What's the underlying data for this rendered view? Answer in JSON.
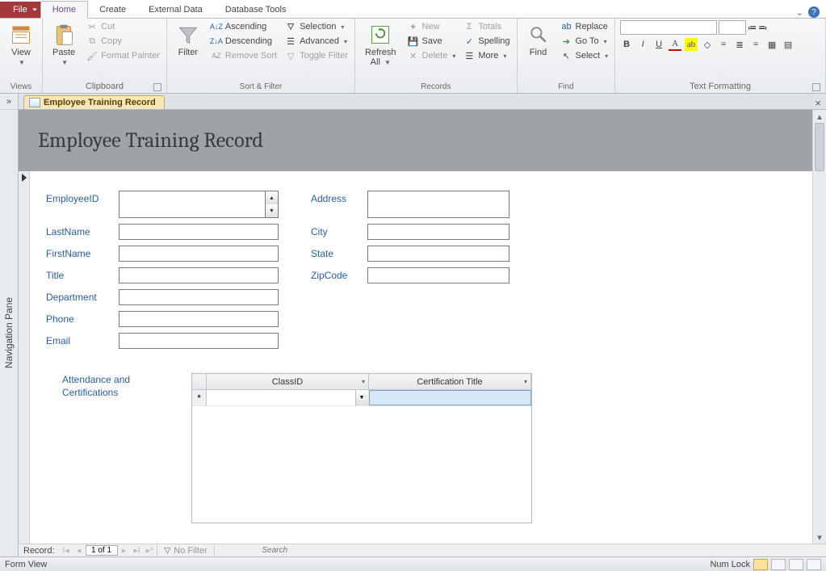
{
  "tabs": {
    "file": "File",
    "home": "Home",
    "create": "Create",
    "external": "External Data",
    "dbtools": "Database Tools"
  },
  "ribbon": {
    "views": {
      "view": "View",
      "group": "Views"
    },
    "clipboard": {
      "paste": "Paste",
      "cut": "Cut",
      "copy": "Copy",
      "painter": "Format Painter",
      "group": "Clipboard"
    },
    "sortfilter": {
      "filter": "Filter",
      "asc": "Ascending",
      "desc": "Descending",
      "remove": "Remove Sort",
      "selection": "Selection",
      "advanced": "Advanced",
      "toggle": "Toggle Filter",
      "group": "Sort & Filter"
    },
    "records": {
      "refresh": "Refresh\nAll",
      "new": "New",
      "save": "Save",
      "delete": "Delete",
      "totals": "Totals",
      "spelling": "Spelling",
      "more": "More",
      "group": "Records"
    },
    "find": {
      "find": "Find",
      "replace": "Replace",
      "goto": "Go To",
      "select": "Select",
      "group": "Find"
    },
    "textfmt": {
      "group": "Text Formatting"
    }
  },
  "docTab": "Employee Training Record",
  "formTitle": "Employee Training Record",
  "fields": {
    "employeeId": "EmployeeID",
    "lastName": "LastName",
    "firstName": "FirstName",
    "title": "Title",
    "department": "Department",
    "phone": "Phone",
    "email": "Email",
    "address": "Address",
    "city": "City",
    "state": "State",
    "zip": "ZipCode"
  },
  "subform": {
    "label": "Attendance and Certifications",
    "col1": "ClassID",
    "col2": "Certification Title"
  },
  "recordNav": {
    "label": "Record:",
    "pos": "1 of 1",
    "nofilter": "No Filter",
    "search": "Search"
  },
  "status": {
    "view": "Form View",
    "numlock": "Num Lock"
  },
  "navPane": "Navigation Pane"
}
